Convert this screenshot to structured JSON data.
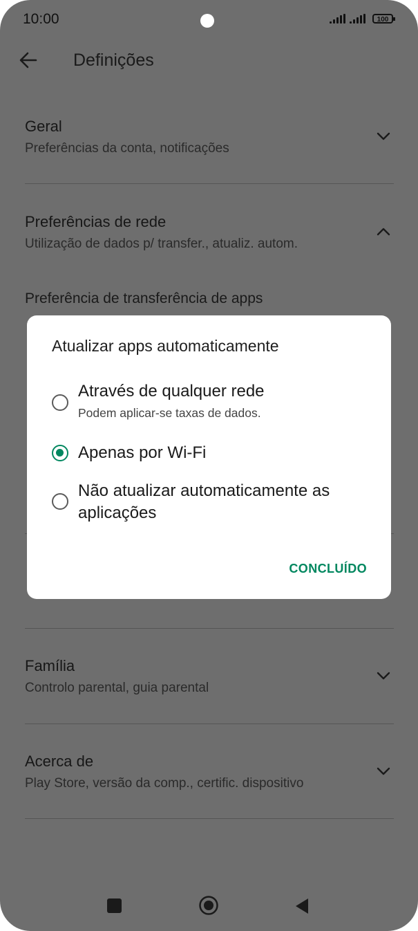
{
  "status_bar": {
    "time": "10:00",
    "battery": "100"
  },
  "app_bar": {
    "title": "Definições"
  },
  "sections": [
    {
      "title": "Geral",
      "subtitle": "Preferências da conta, notificações",
      "expanded": false
    },
    {
      "title": "Preferências de rede",
      "subtitle": "Utilização de dados p/ transfer., atualiz. autom.",
      "expanded": true
    },
    {
      "title": "Família",
      "subtitle": "Controlo parental, guia parental",
      "expanded": false
    },
    {
      "title": "Acerca de",
      "subtitle": "Play Store, versão da comp., certific. dispositivo",
      "expanded": false
    }
  ],
  "background_items": {
    "download_pref": "Preferência de transferência de apps"
  },
  "dialog": {
    "title": "Atualizar apps automaticamente",
    "options": [
      {
        "label": "Através de qualquer rede",
        "sub": "Podem aplicar-se taxas de dados.",
        "selected": false
      },
      {
        "label": "Apenas por Wi-Fi",
        "selected": true
      },
      {
        "label": "Não atualizar automaticamente as aplicações",
        "selected": false
      }
    ],
    "done": "CONCLUÍDO"
  },
  "colors": {
    "accent": "#01875f",
    "scrim_bg": "#6e6e6e"
  },
  "icons": {
    "back": "arrow-left-icon",
    "expand": "chevron-down-icon",
    "collapse": "chevron-up-icon"
  }
}
